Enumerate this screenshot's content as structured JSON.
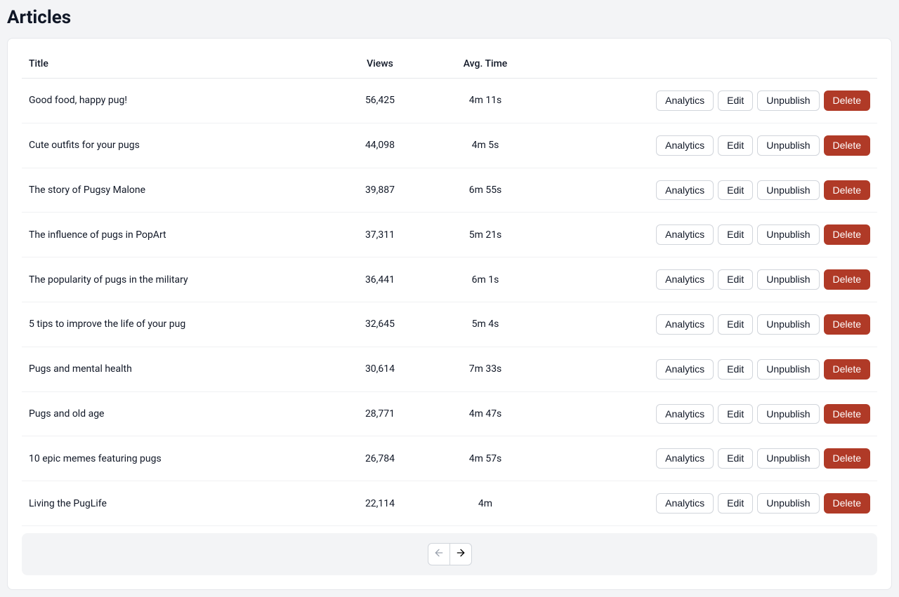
{
  "page": {
    "title": "Articles"
  },
  "columns": {
    "title": "Title",
    "views": "Views",
    "avg_time": "Avg. Time"
  },
  "action_labels": {
    "analytics": "Analytics",
    "edit": "Edit",
    "unpublish": "Unpublish",
    "delete": "Delete"
  },
  "rows": [
    {
      "title": "Good food, happy pug!",
      "views": "56,425",
      "avg_time": "4m 11s"
    },
    {
      "title": "Cute outfits for your pugs",
      "views": "44,098",
      "avg_time": "4m 5s"
    },
    {
      "title": "The story of Pugsy Malone",
      "views": "39,887",
      "avg_time": "6m 55s"
    },
    {
      "title": "The influence of pugs in PopArt",
      "views": "37,311",
      "avg_time": "5m 21s"
    },
    {
      "title": "The popularity of pugs in the military",
      "views": "36,441",
      "avg_time": "6m 1s"
    },
    {
      "title": "5 tips to improve the life of your pug",
      "views": "32,645",
      "avg_time": "5m 4s"
    },
    {
      "title": "Pugs and mental health",
      "views": "30,614",
      "avg_time": "7m 33s"
    },
    {
      "title": "Pugs and old age",
      "views": "28,771",
      "avg_time": "4m 47s"
    },
    {
      "title": "10 epic memes featuring pugs",
      "views": "26,784",
      "avg_time": "4m 57s"
    },
    {
      "title": "Living the PugLife",
      "views": "22,114",
      "avg_time": "4m"
    }
  ],
  "pager": {
    "prev_disabled": true,
    "next_disabled": false
  }
}
